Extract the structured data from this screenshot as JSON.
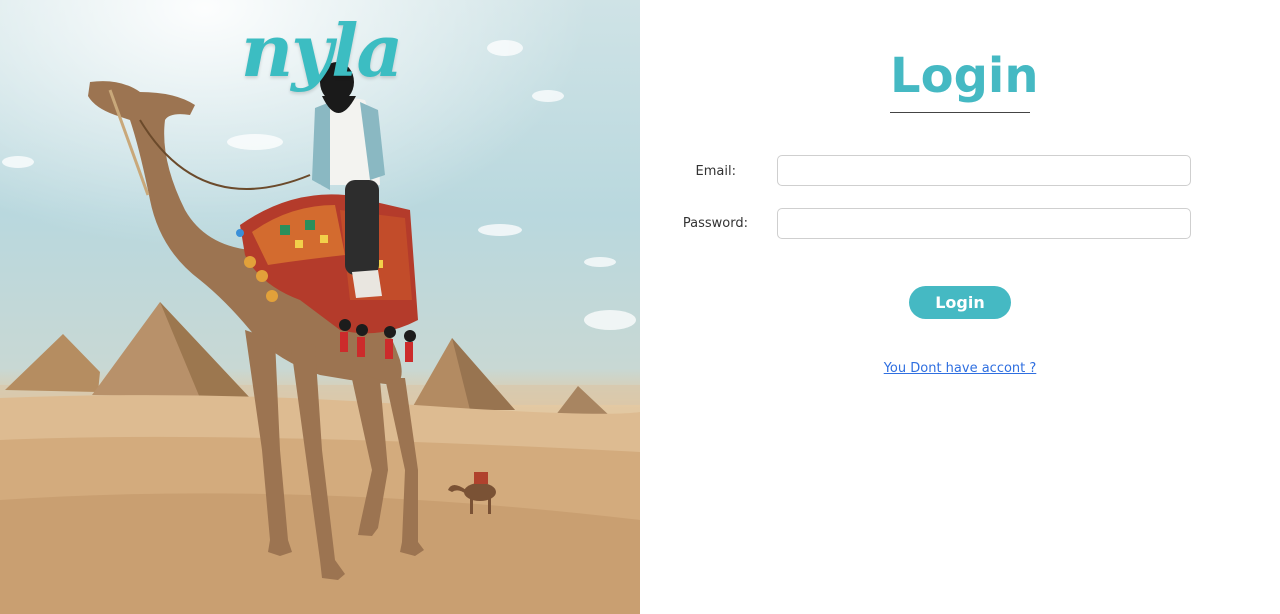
{
  "brand": {
    "name": "nyla"
  },
  "login": {
    "title": "Login",
    "email_label": "Email:",
    "email_value": "",
    "password_label": "Password:",
    "password_value": "",
    "submit_label": "Login",
    "signup_link": "You Dont have accont ?"
  },
  "colors": {
    "accent": "#45b9c3",
    "link": "#2f6fe0"
  }
}
